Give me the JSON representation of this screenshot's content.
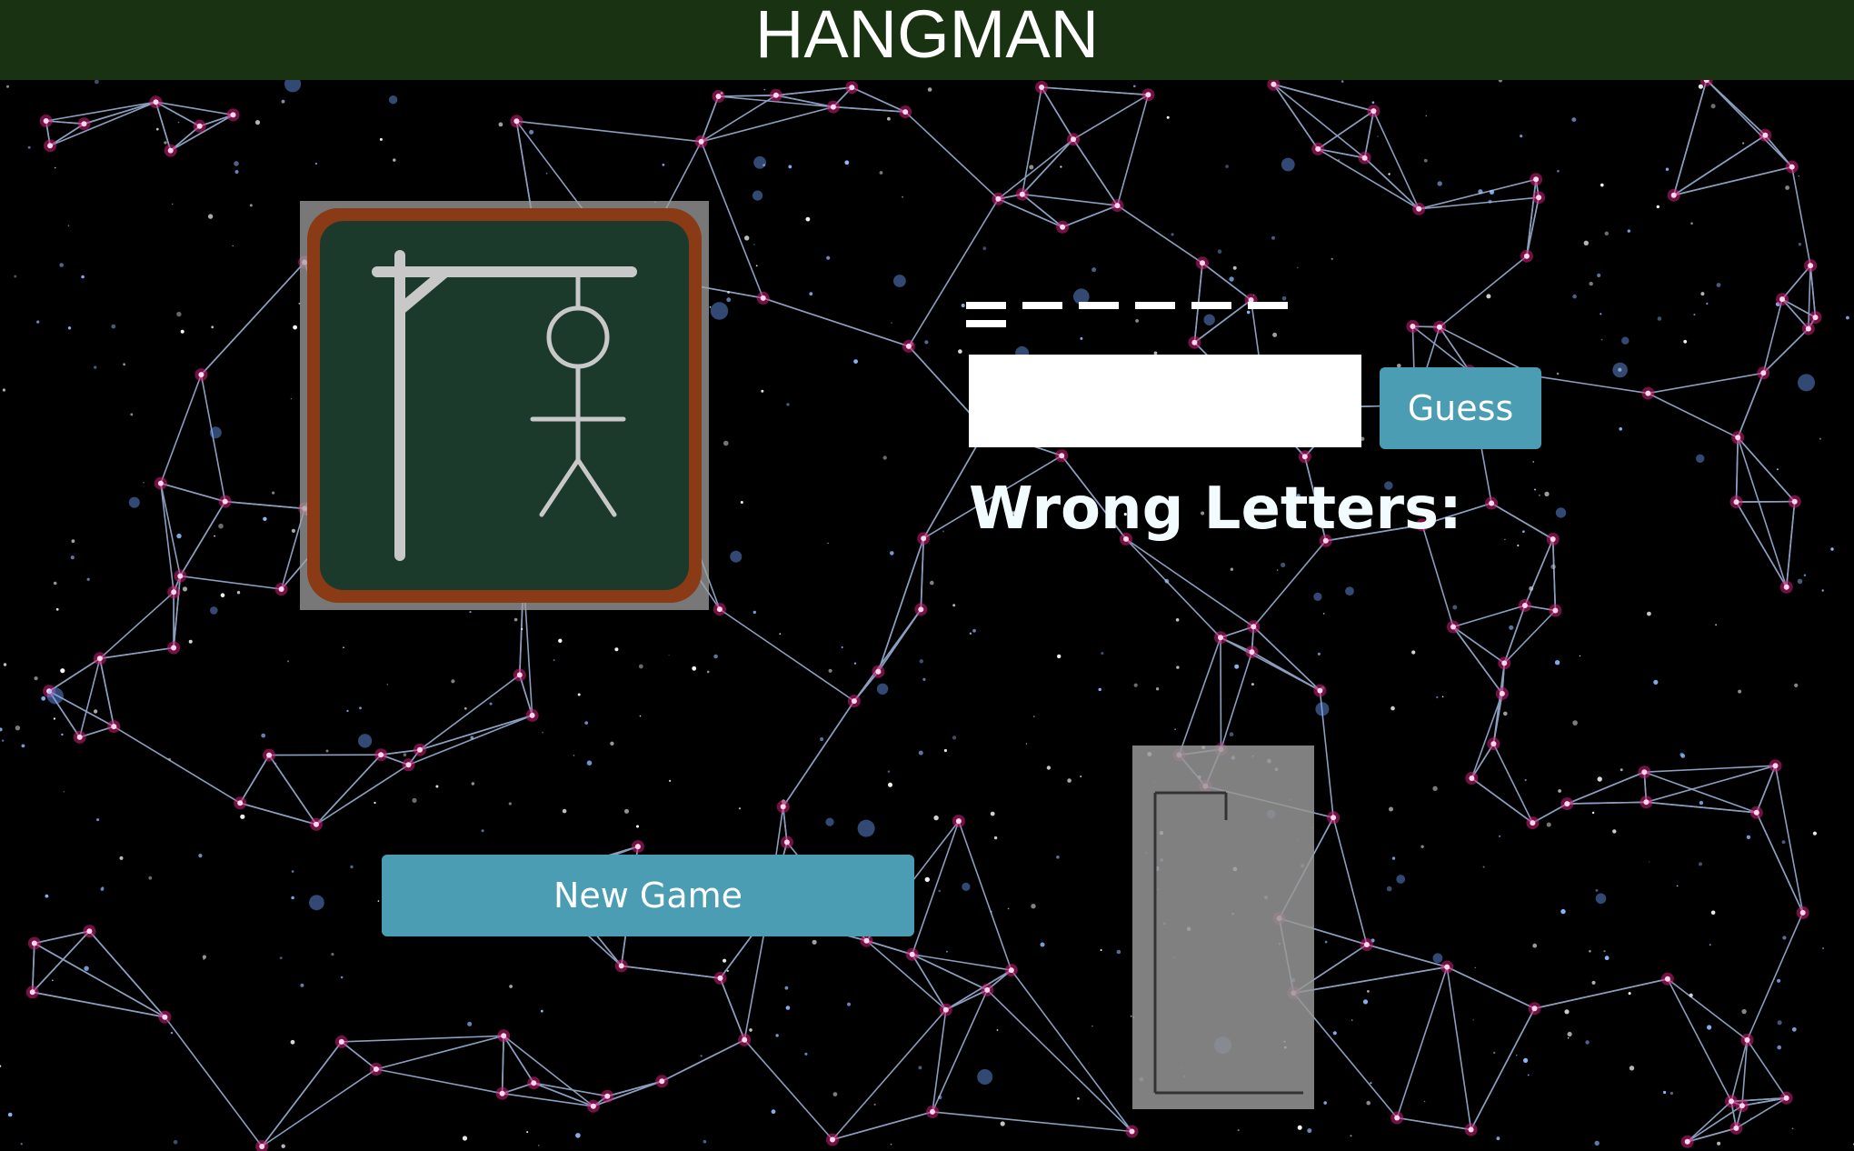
{
  "header": {
    "title": "HANGMAN"
  },
  "game": {
    "word_blank_count": 7,
    "guess_input_value": "",
    "guess_button_label": "Guess",
    "wrong_letters_label": "Wrong Letters:",
    "wrong_letters": "",
    "new_game_label": "New Game",
    "hangman_stage": 0
  },
  "icons": {
    "logo": "hangman-logo-icon",
    "gallows": "gallows-drawing"
  },
  "colors": {
    "header_bg": "#183212",
    "button_bg": "#4a9db2",
    "text_light": "#f2fcff"
  }
}
